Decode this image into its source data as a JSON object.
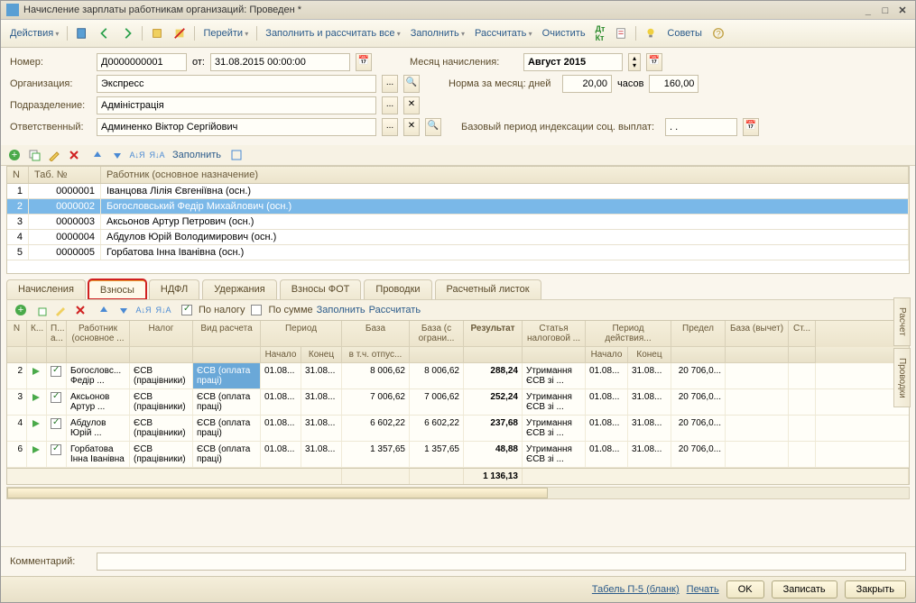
{
  "window": {
    "title": "Начисление зарплаты работникам организаций: Проведен *"
  },
  "toolbar": {
    "actions": "Действия",
    "goto": "Перейти",
    "fill_calc_all": "Заполнить и рассчитать все",
    "fill": "Заполнить",
    "calc": "Рассчитать",
    "clear": "Очистить",
    "hints": "Советы"
  },
  "form": {
    "number_label": "Номер:",
    "number": "Д0000000001",
    "date_label": "от:",
    "date": "31.08.2015 00:00:00",
    "org_label": "Организация:",
    "org": "Экспресс",
    "dept_label": "Подразделение:",
    "dept": "Адміністрація",
    "resp_label": "Ответственный:",
    "resp": "Админенко Віктор Сергійович",
    "month_label": "Месяц начисления:",
    "month": "Август 2015",
    "norm_label": "Норма за месяц: дней",
    "norm_days": "20,00",
    "norm_hours_label": "часов",
    "norm_hours": "160,00",
    "index_label": "Базовый период индексации соц. выплат:",
    "index_val": ". ."
  },
  "emp_grid": {
    "headers": {
      "n": "N",
      "tab": "Таб. №",
      "worker": "Работник (основное назначение)"
    },
    "rows": [
      {
        "n": "1",
        "tab": "0000001",
        "worker": "Іванцова Лілія Євгеніївна (осн.)"
      },
      {
        "n": "2",
        "tab": "0000002",
        "worker": "Богословський Федір Михайлович (осн.)"
      },
      {
        "n": "3",
        "tab": "0000003",
        "worker": "Аксьонов Артур Петрович (осн.)"
      },
      {
        "n": "4",
        "tab": "0000004",
        "worker": "Абдулов Юрій Володимирович (осн.)"
      },
      {
        "n": "5",
        "tab": "0000005",
        "worker": "Горбатова Інна Іванівна (осн.)"
      }
    ]
  },
  "tabs": {
    "accruals": "Начисления",
    "contributions": "Взносы",
    "ndfl": "НДФЛ",
    "deductions": "Удержания",
    "contrib_fot": "Взносы ФОТ",
    "entries": "Проводки",
    "payslip": "Расчетный листок"
  },
  "sub_toolbar": {
    "by_tax": "По налогу",
    "by_sum": "По сумме",
    "fill": "Заполнить",
    "calc": "Рассчитать"
  },
  "detail": {
    "headers": {
      "n": "N",
      "k": "К...",
      "p": "П... а...",
      "worker": "Работник (основное ...",
      "tax": "Налог",
      "calc_type": "Вид расчета",
      "period": "Период",
      "start": "Начало",
      "end": "Конец",
      "base": "База",
      "base_vac": "в т.ч. отпус...",
      "base_lim": "База (с ограни...",
      "result": "Результат",
      "article": "Статья налоговой ...",
      "action_period": "Период действия...",
      "a_start": "Начало",
      "a_end": "Конец",
      "limit": "Предел",
      "base_ded": "База (вычет)",
      "st": "Ст..."
    },
    "rows": [
      {
        "n": "2",
        "worker": "Богословс... Федір ...",
        "tax": "ЄСВ (працівники)",
        "calc_type": "ЄСВ (оплата праці)",
        "start": "01.08...",
        "end": "31.08...",
        "base": "8 006,62",
        "base_lim": "8 006,62",
        "result": "288,24",
        "article": "Утримання ЄСВ зі ...",
        "a_start": "01.08...",
        "a_end": "31.08...",
        "limit": "20 706,0..."
      },
      {
        "n": "3",
        "worker": "Аксьонов Артур ...",
        "tax": "ЄСВ (працівники)",
        "calc_type": "ЄСВ (оплата праці)",
        "start": "01.08...",
        "end": "31.08...",
        "base": "7 006,62",
        "base_lim": "7 006,62",
        "result": "252,24",
        "article": "Утримання ЄСВ зі ...",
        "a_start": "01.08...",
        "a_end": "31.08...",
        "limit": "20 706,0..."
      },
      {
        "n": "4",
        "worker": "Абдулов Юрій ...",
        "tax": "ЄСВ (працівники)",
        "calc_type": "ЄСВ (оплата праці)",
        "start": "01.08...",
        "end": "31.08...",
        "base": "6 602,22",
        "base_lim": "6 602,22",
        "result": "237,68",
        "article": "Утримання ЄСВ зі ...",
        "a_start": "01.08...",
        "a_end": "31.08...",
        "limit": "20 706,0..."
      },
      {
        "n": "6",
        "worker": "Горбатова Інна Іванівна",
        "tax": "ЄСВ (працівники)",
        "calc_type": "ЄСВ (оплата праці)",
        "start": "01.08...",
        "end": "31.08...",
        "base": "1 357,65",
        "base_lim": "1 357,65",
        "result": "48,88",
        "article": "Утримання ЄСВ зі ...",
        "a_start": "01.08...",
        "a_end": "31.08...",
        "limit": "20 706,0..."
      }
    ],
    "total": "1 136,13"
  },
  "side_tabs": {
    "calc": "Расчет",
    "entries": "Проводки"
  },
  "footer": {
    "comment_label": "Комментарий:"
  },
  "bottom": {
    "tabel": "Табель П-5 (бланк)",
    "print": "Печать",
    "ok": "OK",
    "save": "Записать",
    "close": "Закрыть"
  }
}
